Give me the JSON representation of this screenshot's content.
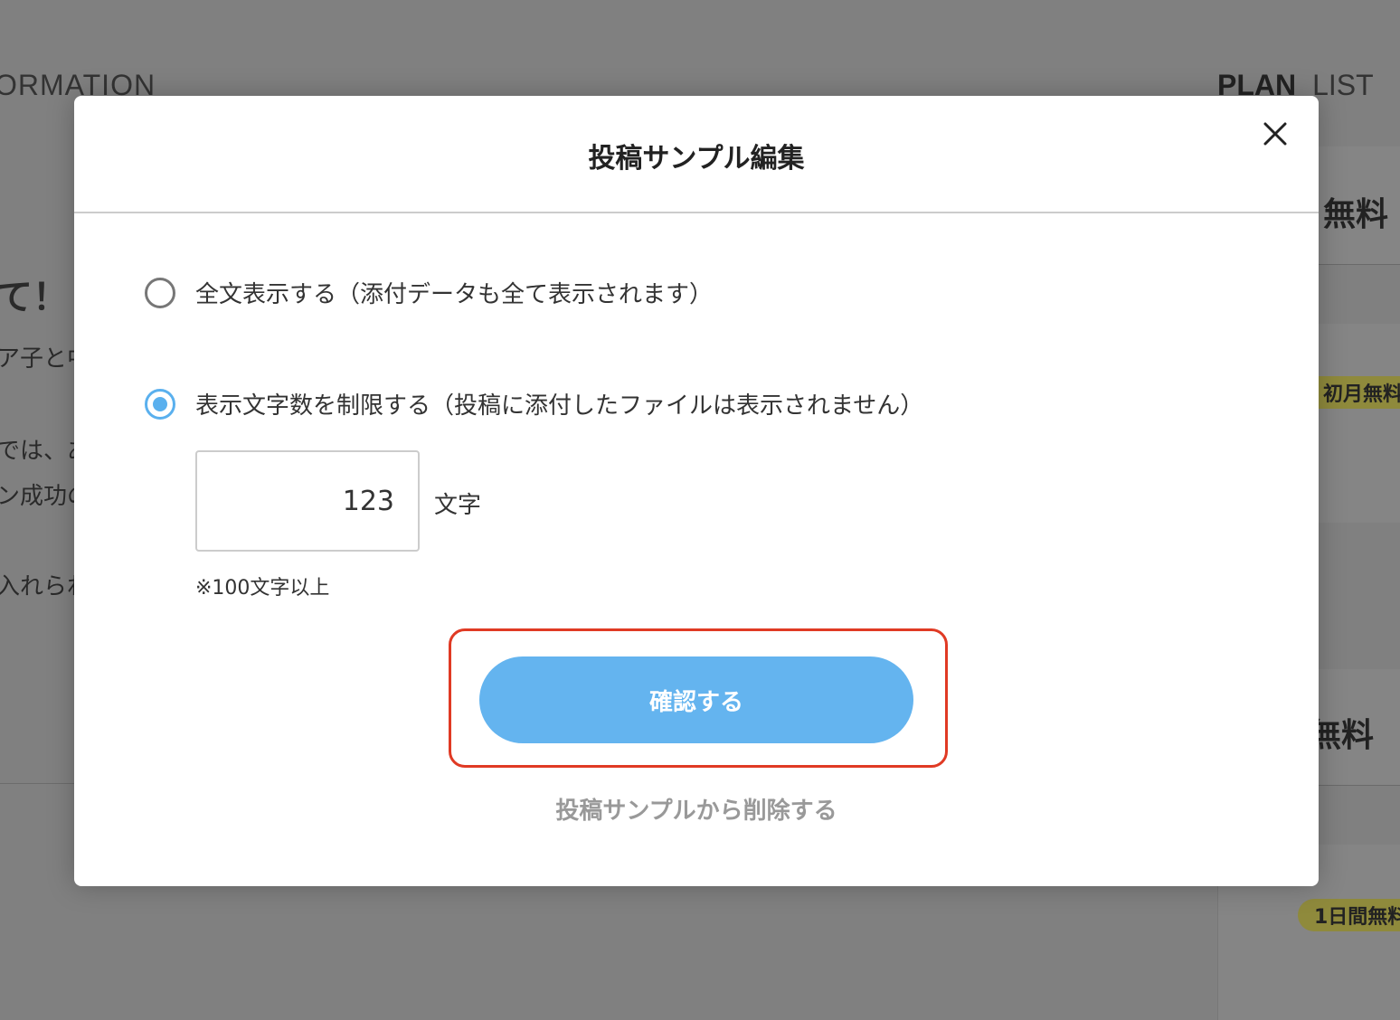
{
  "background": {
    "nav_left": "ORMATION",
    "nav_plan": "PLAN",
    "nav_list": "LIST",
    "article_lines": [
      "て！",
      "ア子と中",
      "では、あ",
      "ン成功の",
      "入れられ"
    ],
    "plan_cards": [
      {
        "title": "無料"
      },
      {
        "badge": "初月無料"
      },
      {
        "title": "無料"
      },
      {
        "badge": "1日間無料"
      }
    ]
  },
  "modal": {
    "title": "投稿サンプル編集",
    "close_icon": "close-icon",
    "options": [
      {
        "label": "全文表示する（添付データも全て表示されます）",
        "selected": false
      },
      {
        "label": "表示文字数を制限する（投稿に添付したファイルは表示されません）",
        "selected": true
      }
    ],
    "char_count_value": "123",
    "char_unit": "文字",
    "char_note": "※100文字以上",
    "confirm_label": "確認する",
    "delete_label": "投稿サンプルから削除する"
  },
  "colors": {
    "accent": "#64b4ef",
    "highlight": "#e03a24",
    "overlay": "#808080"
  }
}
